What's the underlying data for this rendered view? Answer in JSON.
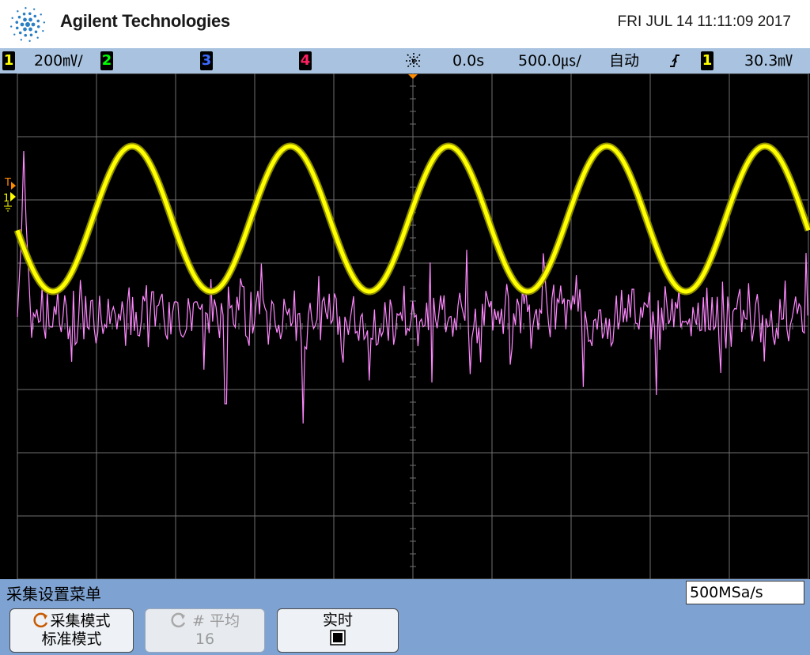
{
  "header": {
    "brand": "Agilent Technologies",
    "datetime": "FRI JUL 14 11:11:09 2017",
    "logo_icon": "agilent-spark-icon"
  },
  "status_bar": {
    "ch1": {
      "number": "1",
      "scale": "200㎷/",
      "color": "#ffff00"
    },
    "ch2": {
      "number": "2",
      "color": "#00ff00"
    },
    "ch3": {
      "number": "3",
      "color": "#3b6bff"
    },
    "ch4": {
      "number": "4",
      "color": "#ff2060"
    },
    "run_icon": "run-status-icon",
    "delay": "0.0s",
    "timebase": "500.0㎲/",
    "trigger_mode": "自动",
    "trigger_slope_icon": "rising-edge-icon",
    "trigger_source": "1",
    "trigger_level": "30.3㎷"
  },
  "screen": {
    "ch1_marker": "1",
    "trigger_marker": "T",
    "colors": {
      "background": "#000000",
      "grid": "#707070",
      "ch1_trace": "#ffff00",
      "math_trace": "#ff88ff",
      "trigger_marker": "#ff8c00"
    },
    "traces": [
      {
        "name": "ch1",
        "shape": "sine",
        "periods_visible": 5,
        "amplitude_div": 1.15,
        "offset_div": 1.7
      },
      {
        "name": "fft",
        "shape": "noise",
        "baseline_div": -0.1
      }
    ]
  },
  "softkeys": {
    "menu_title": "采集设置菜单",
    "sample_rate": "500MSa/s",
    "acq_mode": {
      "line1": "采集模式",
      "line2": "标准模式",
      "icon": "rotate-knob-icon"
    },
    "averages": {
      "line1": "# 平均",
      "line2": "16",
      "icon": "rotate-knob-icon"
    },
    "realtime": {
      "line1": "实时",
      "checkbox": "checked"
    }
  }
}
